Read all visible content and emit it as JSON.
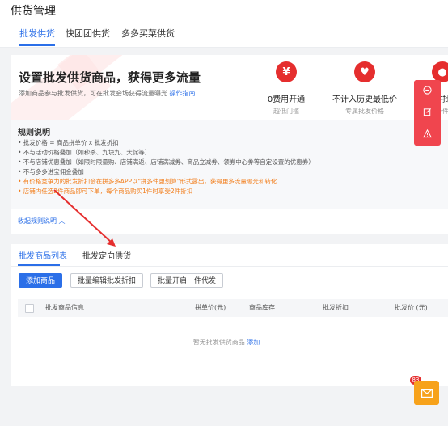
{
  "page": {
    "title": "供货管理"
  },
  "top_tabs": [
    {
      "label": "批发供货",
      "active": true
    },
    {
      "label": "快团团供货",
      "active": false
    },
    {
      "label": "多多买菜供货",
      "active": false
    }
  ],
  "banner": {
    "title": "设置批发供货商品，获得更多流量",
    "subtitle": "添加商品参与批发供货，可在批发会场获得流量曝光",
    "guide_link": "操作指南",
    "features": [
      {
        "icon": "yen-icon",
        "title": "0费用开通",
        "subtitle": "超低门槛"
      },
      {
        "icon": "heart-diamond-icon",
        "title": "不计入历史最低价",
        "subtitle": "专属批发价格"
      },
      {
        "icon": "group-icon",
        "title": "单件批发",
        "subtitle": "仅需一件起批"
      }
    ]
  },
  "rules": {
    "title": "规则说明",
    "items": [
      {
        "text": "• 批发价格 = 商品拼单价 x 批发折扣",
        "highlight": false
      },
      {
        "text": "• 不与活动价格叠加（如秒杀、九块九、大促等）",
        "highlight": false
      },
      {
        "text": "• 不与店铺优惠叠加（如限时限量购、店铺满返、店铺满减券、商品立减券、领券中心券等自定设置的优惠券）",
        "highlight": false
      },
      {
        "text": "• 不与多多进宝佣金叠加",
        "highlight": false
      },
      {
        "text": "• 有价格竞争力的批发折扣会在拼多多APP以\"拼多件更划算\"形式露出，获得更多流量曝光和转化",
        "highlight": true
      },
      {
        "text": "• 店铺内任选2件商品即可下单，每个商品购买1件时享受2件折扣",
        "highlight": true
      }
    ],
    "collapse_label": "收起规则说明 ︿"
  },
  "float_bar": {
    "icons": [
      "minus-circle-icon",
      "edit-icon",
      "warning-icon"
    ]
  },
  "panel": {
    "tabs": [
      {
        "label": "批发商品列表",
        "active": true
      },
      {
        "label": "批发定向供货",
        "active": false
      }
    ],
    "buttons": {
      "add": "添加商品",
      "batch_edit": "批量编辑批发折扣",
      "batch_dropship": "批量开启一件代发"
    },
    "columns": [
      "批发商品信息",
      "拼单价(元)",
      "商品库存",
      "批发折扣",
      "批发价 (元)"
    ],
    "empty_text": "暂无批发供货商品",
    "empty_link": "添加"
  },
  "mail": {
    "badge": "83",
    "icon": "mail-icon"
  }
}
